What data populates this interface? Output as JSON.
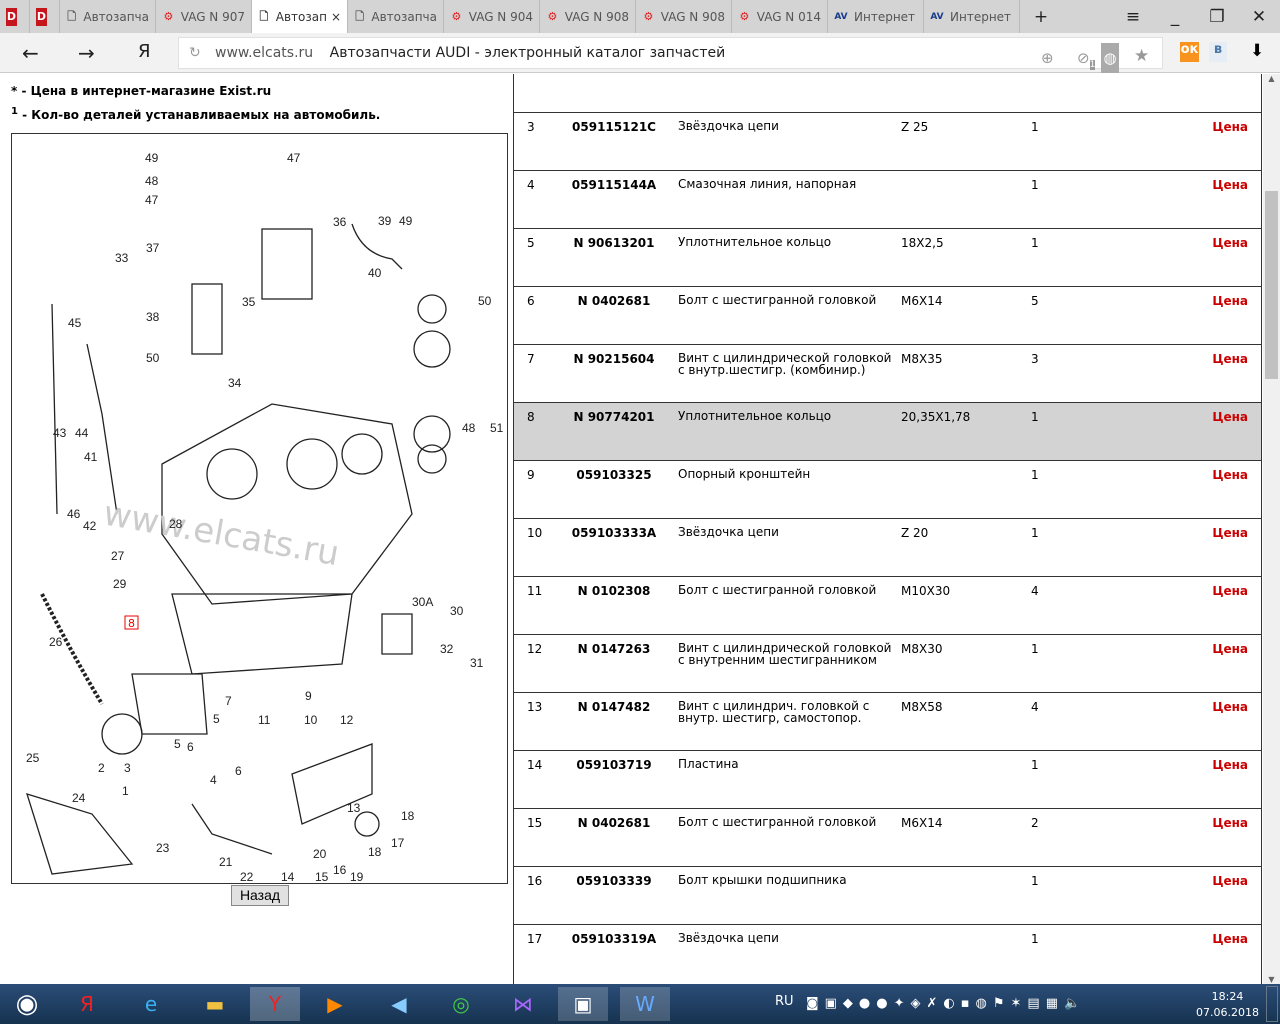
{
  "browser": {
    "tabs": [
      {
        "label": "",
        "icon": "d-icon"
      },
      {
        "label": "",
        "icon": "d-icon"
      },
      {
        "label": "Автозапча",
        "icon": "page-icon"
      },
      {
        "label": "VAG N 907",
        "icon": "elcats-icon"
      },
      {
        "label": "Автозап",
        "icon": "page-icon",
        "active": true
      },
      {
        "label": "Автозапча",
        "icon": "page-icon"
      },
      {
        "label": "VAG N 904",
        "icon": "elcats-icon"
      },
      {
        "label": "VAG N 908",
        "icon": "elcats-icon"
      },
      {
        "label": "VAG N 908",
        "icon": "elcats-icon"
      },
      {
        "label": "VAG N 014",
        "icon": "elcats-icon"
      },
      {
        "label": "Интернет",
        "icon": "avto-icon"
      },
      {
        "label": "Интернет",
        "icon": "avto-icon"
      }
    ],
    "domain": "www.elcats.ru",
    "page_title": "Автозапчасти AUDI - электронный каталог запчастей",
    "yandex": "Я",
    "badge_count": "1"
  },
  "notes": {
    "price_note": "* - Цена в интернет-магазине Exist.ru",
    "qty_sup": "1",
    "qty_note": " - Кол-во деталей устанавливаемых на автомобиль."
  },
  "diagram": {
    "watermark": "www.elcats.ru",
    "highlighted_label": "8",
    "labels": [
      "49",
      "48",
      "47",
      "47",
      "33",
      "37",
      "38",
      "50",
      "36",
      "39",
      "49",
      "40",
      "35",
      "50",
      "45",
      "34",
      "43",
      "44",
      "48",
      "51",
      "41",
      "46",
      "42",
      "28",
      "27",
      "29",
      "30A",
      "30",
      "26",
      "32",
      "31",
      "9",
      "7",
      "5",
      "5",
      "6",
      "6",
      "4",
      "11",
      "10",
      "12",
      "2",
      "3",
      "1",
      "25",
      "24",
      "13",
      "18",
      "17",
      "18",
      "23",
      "21",
      "20",
      "16",
      "22",
      "14",
      "15",
      "19"
    ],
    "back_button": "Назад"
  },
  "table": {
    "rows": [
      {
        "num": "3",
        "part": "059115121C",
        "desc": "Звёздочка цепи",
        "size": "Z 25",
        "qty": "1",
        "price": "Цена"
      },
      {
        "num": "4",
        "part": "059115144A",
        "desc": "Смазочная линия, напорная",
        "size": "",
        "qty": "1",
        "price": "Цена"
      },
      {
        "num": "5",
        "part": "N 90613201",
        "desc": "Уплотнительное кольцо",
        "size": "18X2,5",
        "qty": "1",
        "price": "Цена"
      },
      {
        "num": "6",
        "part": "N 0402681",
        "desc": "Болт с шестигранной головкой",
        "size": "M6X14",
        "qty": "5",
        "price": "Цена"
      },
      {
        "num": "7",
        "part": "N 90215604",
        "desc": "Винт с цилиндрической головкой с внутр.шестигр. (комбинир.)",
        "size": "M8X35",
        "qty": "3",
        "price": "Цена"
      },
      {
        "num": "8",
        "part": "N 90774201",
        "desc": "Уплотнительное кольцо",
        "size": "20,35X1,78",
        "qty": "1",
        "price": "Цена",
        "highlighted": true
      },
      {
        "num": "9",
        "part": "059103325",
        "desc": "Опорный кронштейн",
        "size": "",
        "qty": "1",
        "price": "Цена"
      },
      {
        "num": "10",
        "part": "059103333A",
        "desc": "Звёздочка цепи",
        "size": "Z 20",
        "qty": "1",
        "price": "Цена"
      },
      {
        "num": "11",
        "part": "N 0102308",
        "desc": "Болт с шестигранной головкой",
        "size": "M10X30",
        "qty": "4",
        "price": "Цена"
      },
      {
        "num": "12",
        "part": "N 0147263",
        "desc": "Винт с цилиндрической головкой с внутренним шестигранником",
        "size": "M8X30",
        "qty": "1",
        "price": "Цена"
      },
      {
        "num": "13",
        "part": "N 0147482",
        "desc": "Винт с цилиндрич. головкой с внутр. шестигр, самостопор.",
        "size": "M8X58",
        "qty": "4",
        "price": "Цена"
      },
      {
        "num": "14",
        "part": "059103719",
        "desc": "Пластина",
        "size": "",
        "qty": "1",
        "price": "Цена"
      },
      {
        "num": "15",
        "part": "N 0402681",
        "desc": "Болт с шестигранной головкой",
        "size": "M6X14",
        "qty": "2",
        "price": "Цена"
      },
      {
        "num": "16",
        "part": "059103339",
        "desc": "Болт крышки подшипника",
        "size": "",
        "qty": "1",
        "price": "Цена"
      },
      {
        "num": "17",
        "part": "059103319A",
        "desc": "Звёздочка цепи",
        "size": "",
        "qty": "1",
        "price": "Цена"
      }
    ],
    "price_color": "#cc0000",
    "highlight_color": "#d3d3d3"
  },
  "taskbar": {
    "language": "RU",
    "time": "18:24",
    "date": "07.06.2018"
  }
}
